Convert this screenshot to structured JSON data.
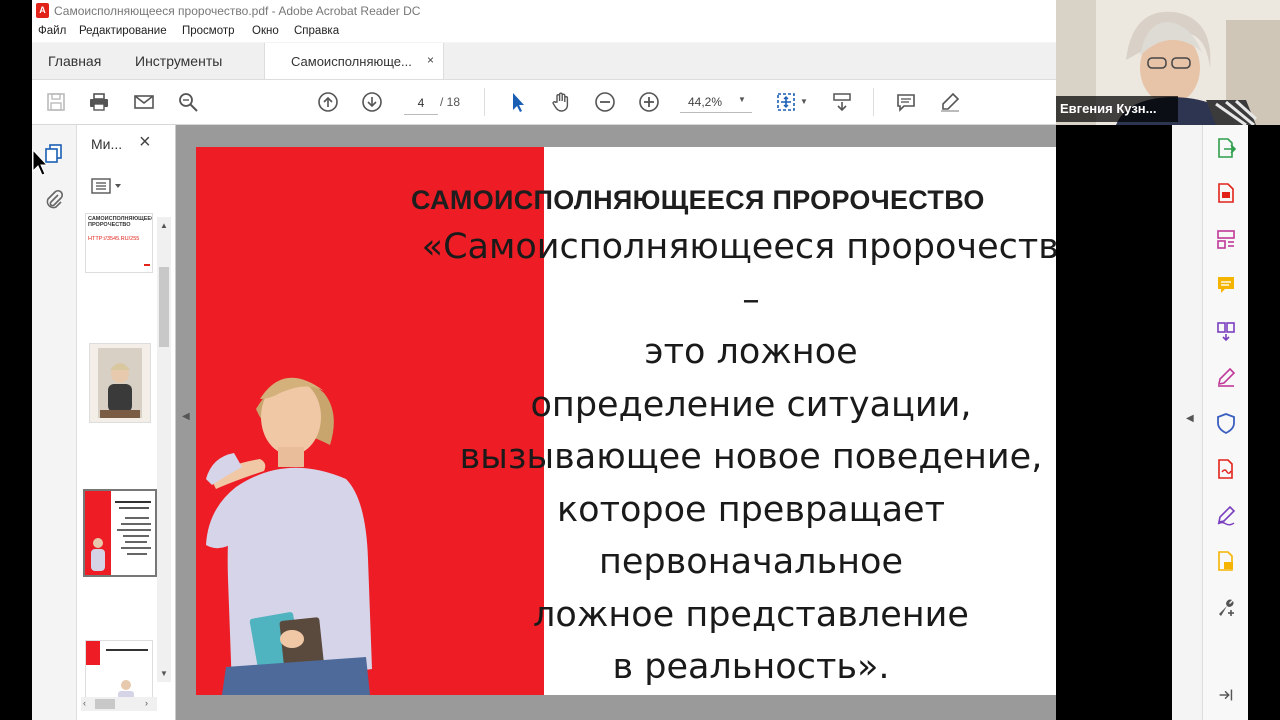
{
  "window": {
    "title": "Самоисполняющееся пророчество.pdf - Adobe Acrobat Reader DC"
  },
  "menu": [
    "Файл",
    "Редактирование",
    "Просмотр",
    "Окно",
    "Справка"
  ],
  "tabs": {
    "home": "Главная",
    "tools": "Инструменты",
    "document": "Самоисполняюще...",
    "close": "×"
  },
  "toolbar": {
    "current_page": "4",
    "total_pages": "/ 18",
    "zoom": "44,2%"
  },
  "thumbnails_panel": {
    "title": "Ми...",
    "close": "×",
    "thumb1_title": "САМОИСПОЛНЯЮЩЕЕСЯ ПРОРОЧЕСТВО",
    "thumb1_link": "HTTP://3545.RU/255"
  },
  "slide": {
    "title": "САМОИСПОЛНЯЮЩЕЕСЯ ПРОРОЧЕСТВО",
    "lines": [
      "«Самоисполняющееся пророчество",
      "–",
      "это ложное",
      "определение ситуации,",
      "вызывающее новое поведение,",
      "которое превращает",
      "первоначальное",
      "ложное представление",
      "в реальность»."
    ],
    "accent_color": "#ee1c25"
  },
  "webcam": {
    "participant_name": "Евгения Кузн..."
  },
  "watermark": "zoom"
}
